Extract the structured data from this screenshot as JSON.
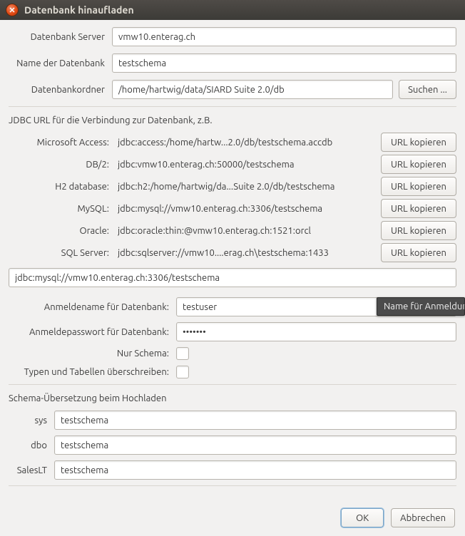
{
  "window": {
    "title": "Datenbank hinaufladen"
  },
  "top": {
    "server_label": "Datenbank Server",
    "server_value": "vmw10.enterag.ch",
    "dbname_label": "Name der Datenbank",
    "dbname_value": "testschema",
    "folder_label": "Datenbankordner",
    "folder_value": "/home/hartwig/data/SIARD Suite 2.0/db",
    "search_btn": "Suchen ..."
  },
  "jdbc": {
    "heading": "JDBC URL für die Verbindung zur Datenbank, z.B.",
    "copy_btn": "URL kopieren",
    "rows": [
      {
        "label": "Microsoft Access:",
        "value": "jdbc:access:/home/hartw...2.0/db/testschema.accdb"
      },
      {
        "label": "DB/2:",
        "value": "jdbc:vmw10.enterag.ch:50000/testschema"
      },
      {
        "label": "H2 database:",
        "value": "jdbc:h2:/home/hartwig/da...Suite 2.0/db/testschema"
      },
      {
        "label": "MySQL:",
        "value": "jdbc:mysql://vmw10.enterag.ch:3306/testschema"
      },
      {
        "label": "Oracle:",
        "value": "jdbc:oracle:thin:@vmw10.enterag.ch:1521:orcl"
      },
      {
        "label": "SQL Server:",
        "value": "jdbc:sqlserver://vmw10....erag.ch\\testschema:1433"
      }
    ],
    "input_value": "jdbc:mysql://vmw10.enterag.ch:3306/testschema"
  },
  "auth": {
    "user_label": "Anmeldename für Datenbank:",
    "user_value": "testuser",
    "pass_label": "Anmeldepasswort für Datenbank:",
    "pass_value": "•••••••",
    "schema_only_label": "Nur Schema:",
    "overwrite_label": "Typen und Tabellen überschreiben:"
  },
  "mapping": {
    "heading": "Schema-Übersetzung beim Hochladen",
    "rows": [
      {
        "label": "sys",
        "value": "testschema"
      },
      {
        "label": "dbo",
        "value": "testschema"
      },
      {
        "label": "SalesLT",
        "value": "testschema"
      }
    ]
  },
  "footer": {
    "ok": "OK",
    "cancel": "Abbrechen"
  },
  "tooltip": "Name für Anmeldung b"
}
